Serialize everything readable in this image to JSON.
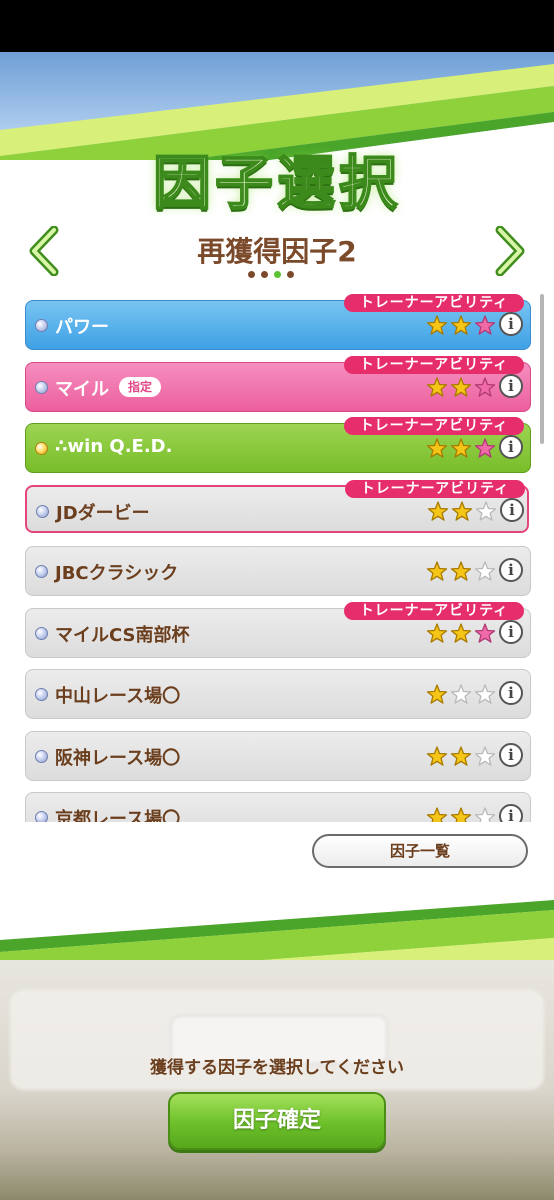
{
  "header": {
    "title": "因子選択",
    "subtitle": "再獲得因子2",
    "page_count": 4,
    "active_page": 3
  },
  "factors": [
    {
      "name": "パワー",
      "color": "blue",
      "bullet": "silver",
      "stars": 3,
      "trainer_ability": true,
      "badge": "",
      "selected": false
    },
    {
      "name": "マイル",
      "color": "pink",
      "bullet": "silver",
      "stars": 3,
      "trainer_ability": true,
      "badge": "指定",
      "selected": false
    },
    {
      "name": "∴win Q.E.D.",
      "color": "green",
      "bullet": "gold",
      "stars": 3,
      "trainer_ability": true,
      "badge": "",
      "selected": false
    },
    {
      "name": "JDダービー",
      "color": "gray",
      "bullet": "silver",
      "stars": 2,
      "trainer_ability": true,
      "badge": "",
      "selected": true
    },
    {
      "name": "JBCクラシック",
      "color": "gray",
      "bullet": "silver",
      "stars": 2,
      "trainer_ability": false,
      "badge": "",
      "selected": false
    },
    {
      "name": "マイルCS南部杯",
      "color": "gray",
      "bullet": "silver",
      "stars": 3,
      "trainer_ability": true,
      "badge": "",
      "selected": false
    },
    {
      "name": "中山レース場〇",
      "color": "gray",
      "bullet": "silver",
      "stars": 1,
      "trainer_ability": false,
      "badge": "",
      "selected": false
    },
    {
      "name": "阪神レース場〇",
      "color": "gray",
      "bullet": "silver",
      "stars": 2,
      "trainer_ability": false,
      "badge": "",
      "selected": false
    },
    {
      "name": "京都レース場〇",
      "color": "gray",
      "bullet": "silver",
      "stars": 2,
      "trainer_ability": false,
      "badge": "",
      "selected": false
    }
  ],
  "labels": {
    "trainer_ability": "トレーナーアビリティ",
    "info": "i",
    "factor_list_button": "因子一覧",
    "prompt": "獲得する因子を選択してください",
    "confirm_button": "因子確定"
  },
  "colors": {
    "blue": "#3ea1e5",
    "pink": "#ec5e9e",
    "green": "#78bd2a",
    "gray": "#dcdcdc",
    "ability_tag": "#e72e6c",
    "text_brown": "#6b3f1e",
    "star_gold": "#f5c518",
    "star_pink": "#f06aa8"
  }
}
